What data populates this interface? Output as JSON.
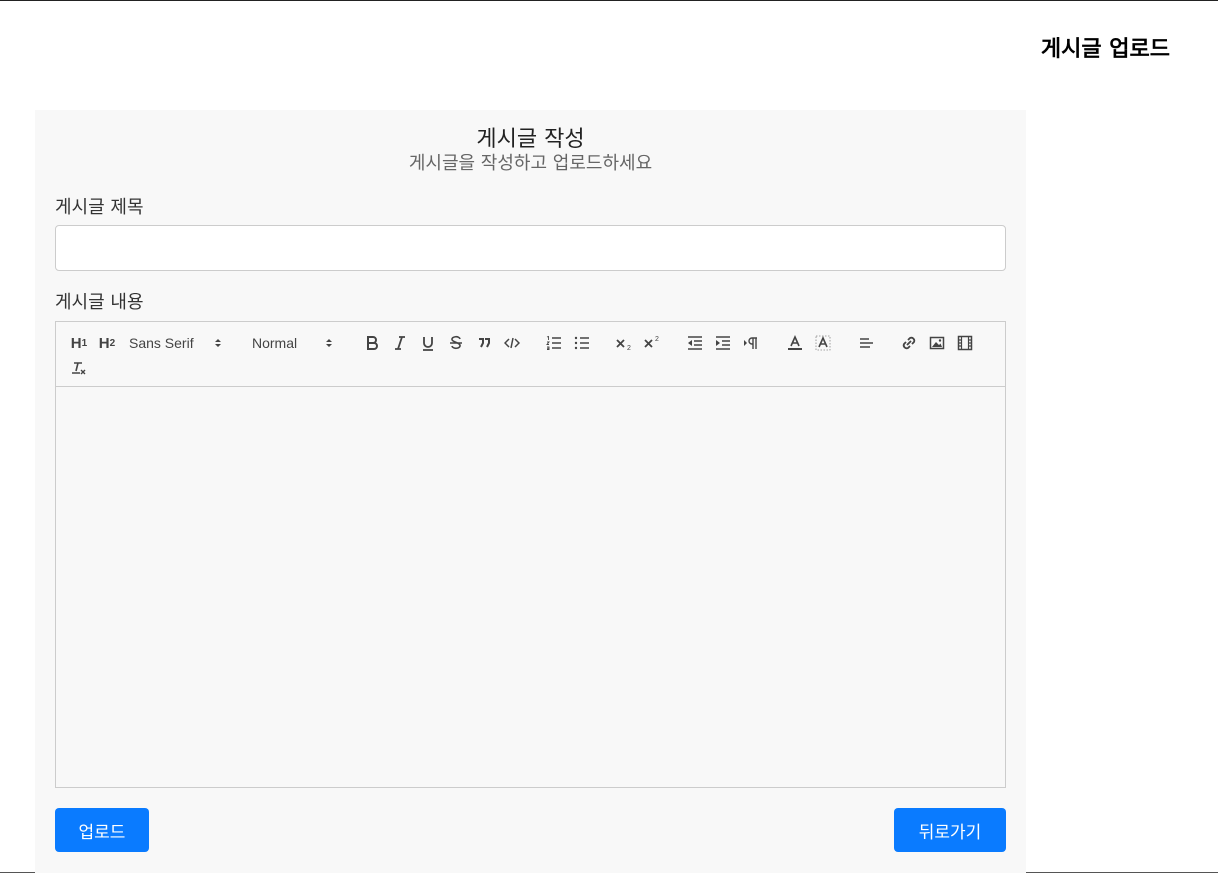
{
  "header": {
    "title": "게시글 업로드"
  },
  "form": {
    "title": "게시글 작성",
    "subtitle": "게시글을 작성하고 업로드하세요",
    "title_label": "게시글 제목",
    "title_value": "",
    "content_label": "게시글 내용",
    "content_value": ""
  },
  "toolbar": {
    "h1_label": "H",
    "h1_sub": "1",
    "h2_label": "H",
    "h2_sub": "2",
    "font_value": "Sans Serif",
    "size_value": "Normal"
  },
  "buttons": {
    "upload_label": "업로드",
    "back_label": "뒤로가기"
  },
  "colors": {
    "accent": "#0a7bff",
    "card_bg": "#f8f8f8"
  }
}
